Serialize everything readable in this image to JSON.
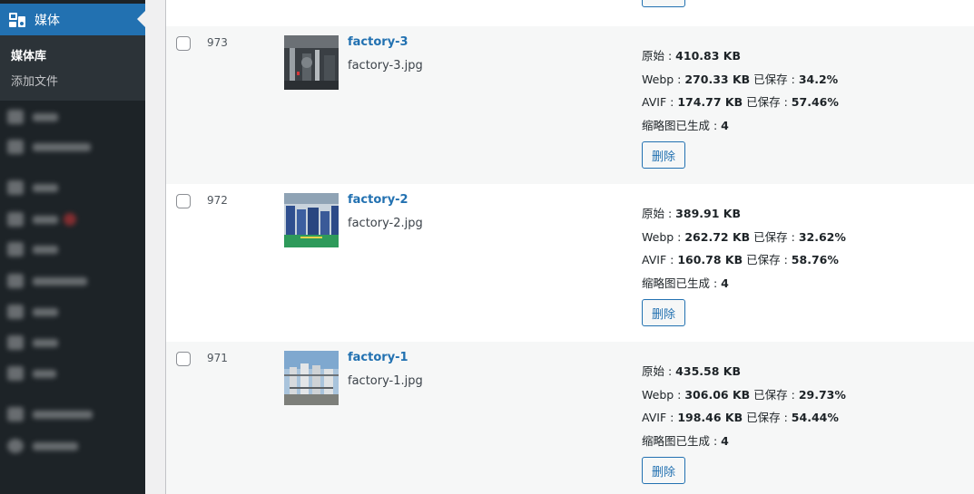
{
  "sidebar": {
    "current_menu": {
      "label": "媒体",
      "icon": "media-icon"
    },
    "submenu": {
      "current": "媒体库",
      "add_new": "添加文件"
    },
    "accent_color": "#2271b1"
  },
  "media_rows": [
    {
      "id": "973",
      "title": "factory-3",
      "filename": "factory-3.jpg",
      "original_label": "原始 : ",
      "original_size": "410.83 KB",
      "webp_label": "Webp : ",
      "webp_size": "270.33 KB",
      "webp_saved_label": " 已保存 : ",
      "webp_saved": "34.2%",
      "avif_label": "AVIF : ",
      "avif_size": "174.77 KB",
      "avif_saved_label": " 已保存 : ",
      "avif_saved": "57.46%",
      "thumbs_label": "缩略图已生成 : ",
      "thumbs_count": "4",
      "delete_label": "删除"
    },
    {
      "id": "972",
      "title": "factory-2",
      "filename": "factory-2.jpg",
      "original_label": "原始 : ",
      "original_size": "389.91 KB",
      "webp_label": "Webp : ",
      "webp_size": "262.72 KB",
      "webp_saved_label": " 已保存 : ",
      "webp_saved": "32.62%",
      "avif_label": "AVIF : ",
      "avif_size": "160.78 KB",
      "avif_saved_label": " 已保存 : ",
      "avif_saved": "58.76%",
      "thumbs_label": "缩略图已生成 : ",
      "thumbs_count": "4",
      "delete_label": "删除"
    },
    {
      "id": "971",
      "title": "factory-1",
      "filename": "factory-1.jpg",
      "original_label": "原始 : ",
      "original_size": "435.58 KB",
      "webp_label": "Webp : ",
      "webp_size": "306.06 KB",
      "webp_saved_label": " 已保存 : ",
      "webp_saved": "29.73%",
      "avif_label": "AVIF : ",
      "avif_size": "198.46 KB",
      "avif_saved_label": " 已保存 : ",
      "avif_saved": "54.44%",
      "thumbs_label": "缩略图已生成 : ",
      "thumbs_count": "4",
      "delete_label": "删除"
    }
  ]
}
